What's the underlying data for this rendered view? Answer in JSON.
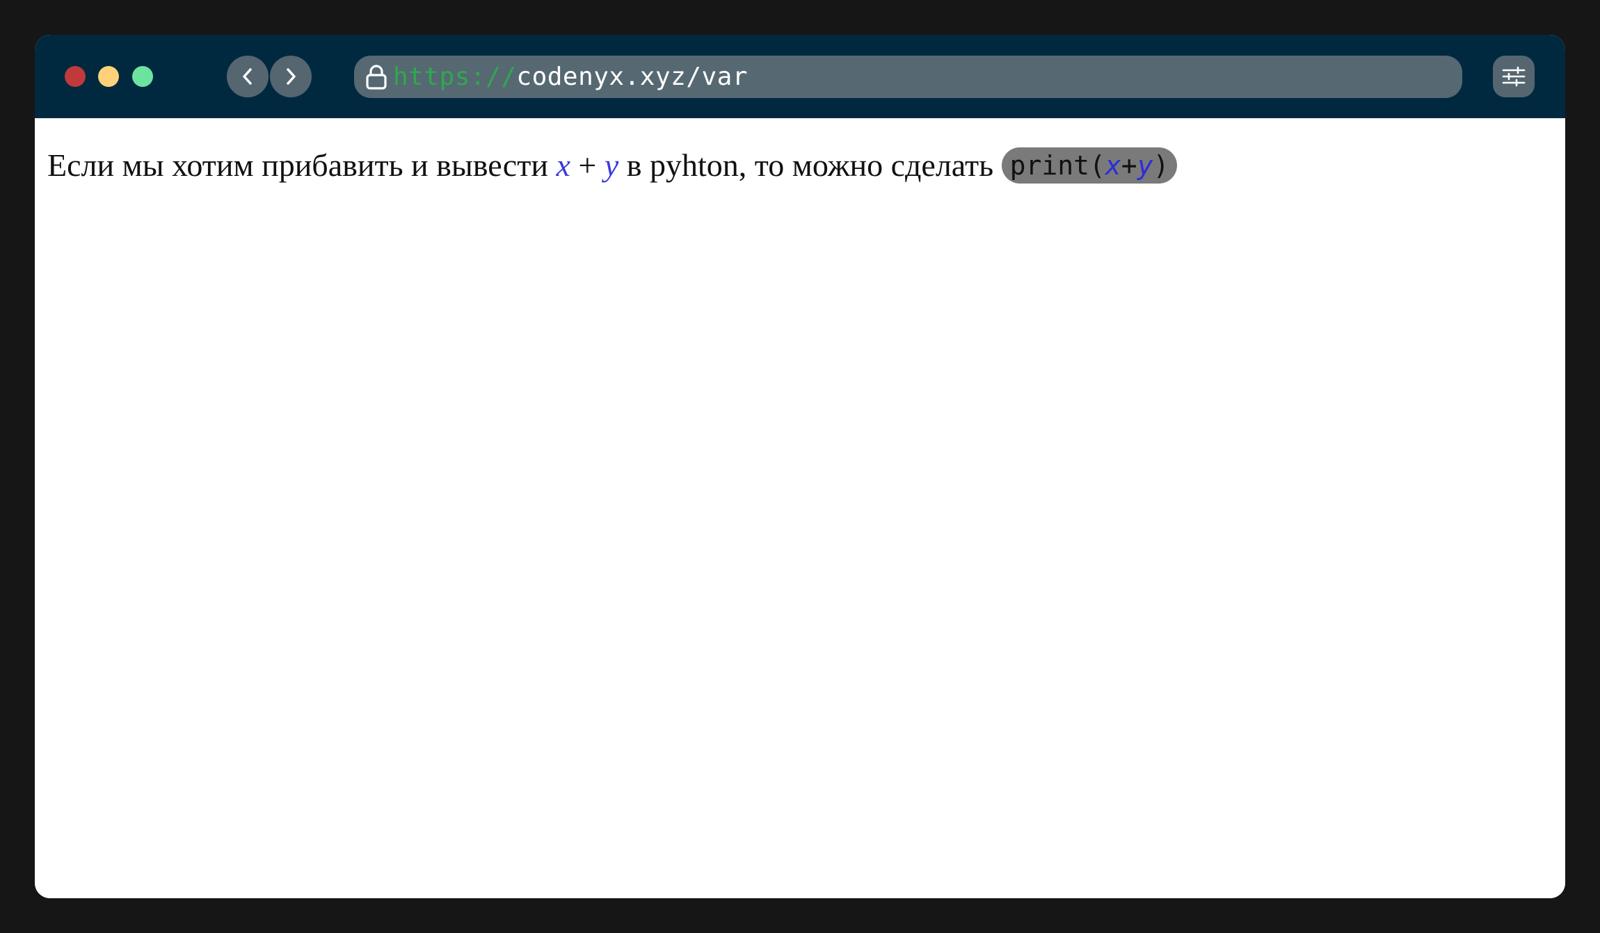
{
  "browser": {
    "url_scheme": "https://",
    "url_host": "codenyx.xyz/var",
    "back_icon": "chevron-left-icon",
    "forward_icon": "chevron-right-icon",
    "lock_icon": "lock-icon",
    "settings_icon": "sliders-icon",
    "colors": {
      "titlebar": "#002940",
      "close": "#c0393b",
      "minimize": "#ffd27a",
      "maximize": "#6de3a0",
      "scheme": "#2fa84f"
    }
  },
  "page": {
    "text_before": "Если мы хотим прибавить и вывести ",
    "math_x": "x",
    "math_plus": " + ",
    "math_y": "y",
    "text_after": " в pyhton, то можно сделать ",
    "code_prefix": "print(",
    "code_x": "x",
    "code_plus": "+",
    "code_y": "y",
    "code_suffix": ")",
    "colors": {
      "variable": "#3b3bdb",
      "code_background": "#7a7a7a"
    }
  }
}
